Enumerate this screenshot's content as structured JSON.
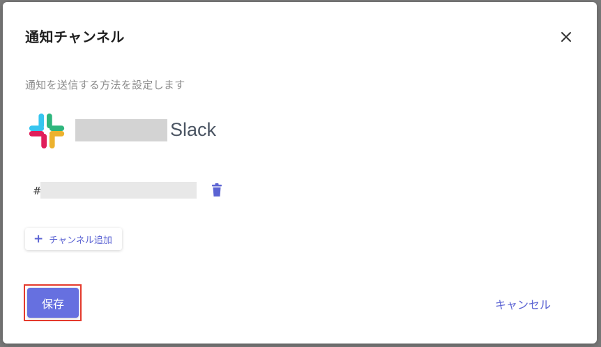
{
  "dialog": {
    "title": "通知チャンネル",
    "description": "通知を送信する方法を設定します"
  },
  "integration": {
    "service_name": "Slack",
    "logo_icon": "slack-logo-icon",
    "logo_colors": [
      "#36c5f0",
      "#2eb67d",
      "#ecb22e",
      "#e01e5a"
    ]
  },
  "channel": {
    "prefix": "#",
    "delete_icon": "trash-icon"
  },
  "actions": {
    "add_channel_label": "チャンネル追加",
    "save_label": "保存",
    "cancel_label": "キャンセル"
  },
  "colors": {
    "accent": "#6670e0",
    "link": "#5b63d3",
    "highlight_border": "#e53a2c"
  }
}
